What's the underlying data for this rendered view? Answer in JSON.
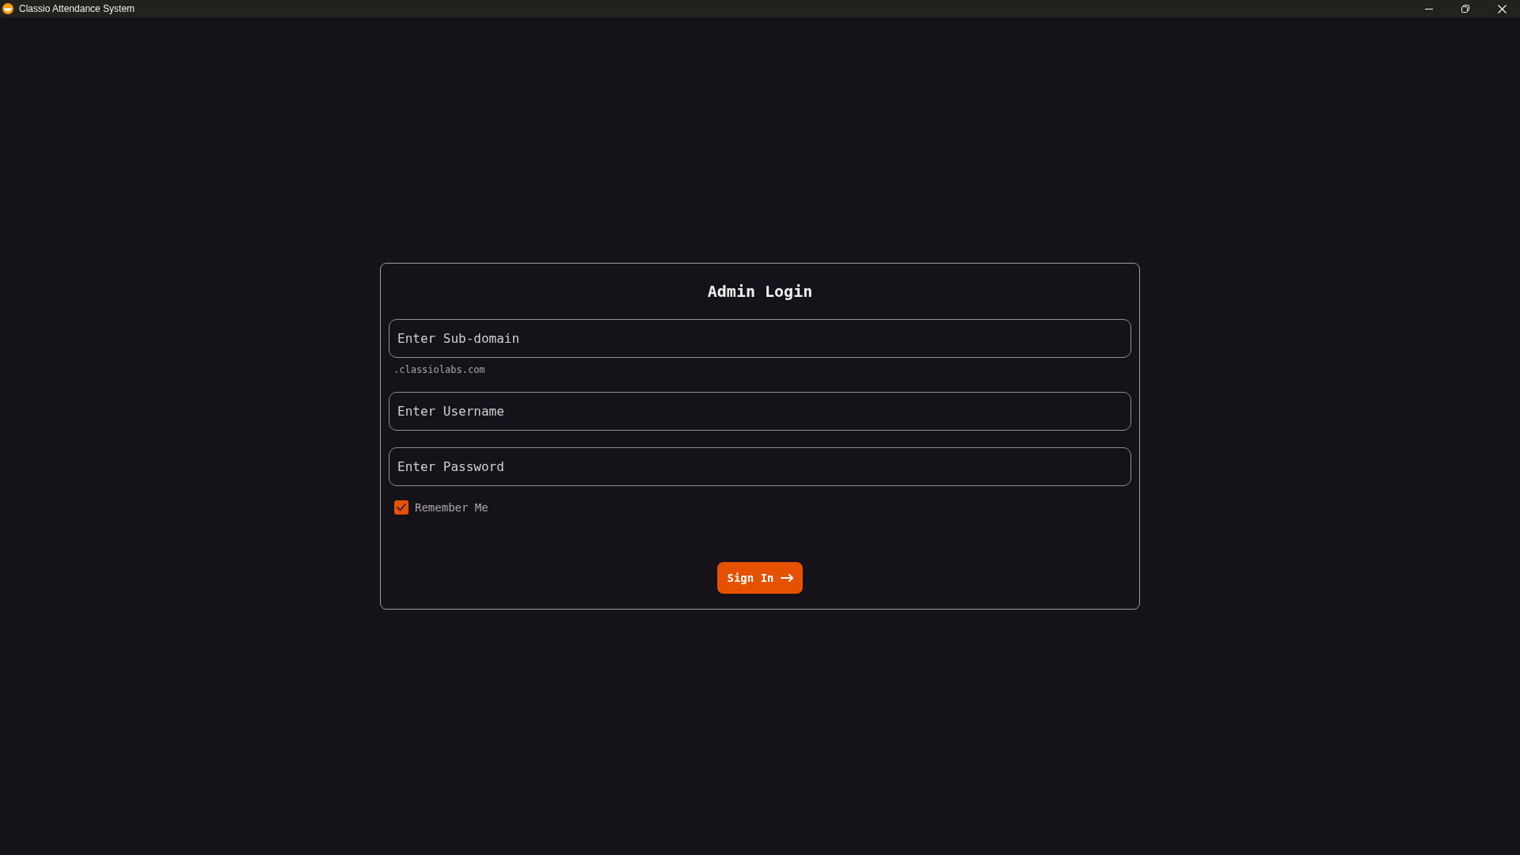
{
  "window": {
    "title": "Classio Attendance System"
  },
  "login_form": {
    "title": "Admin Login",
    "fields": [
      {
        "placeholder": "Enter Sub-domain",
        "hint": ".classiolabs.com"
      },
      {
        "placeholder": "Enter Username"
      },
      {
        "placeholder": "Enter Password"
      }
    ],
    "remember": {
      "label": "Remember Me",
      "checked": true
    },
    "submit": {
      "label": "Sign In"
    }
  }
}
